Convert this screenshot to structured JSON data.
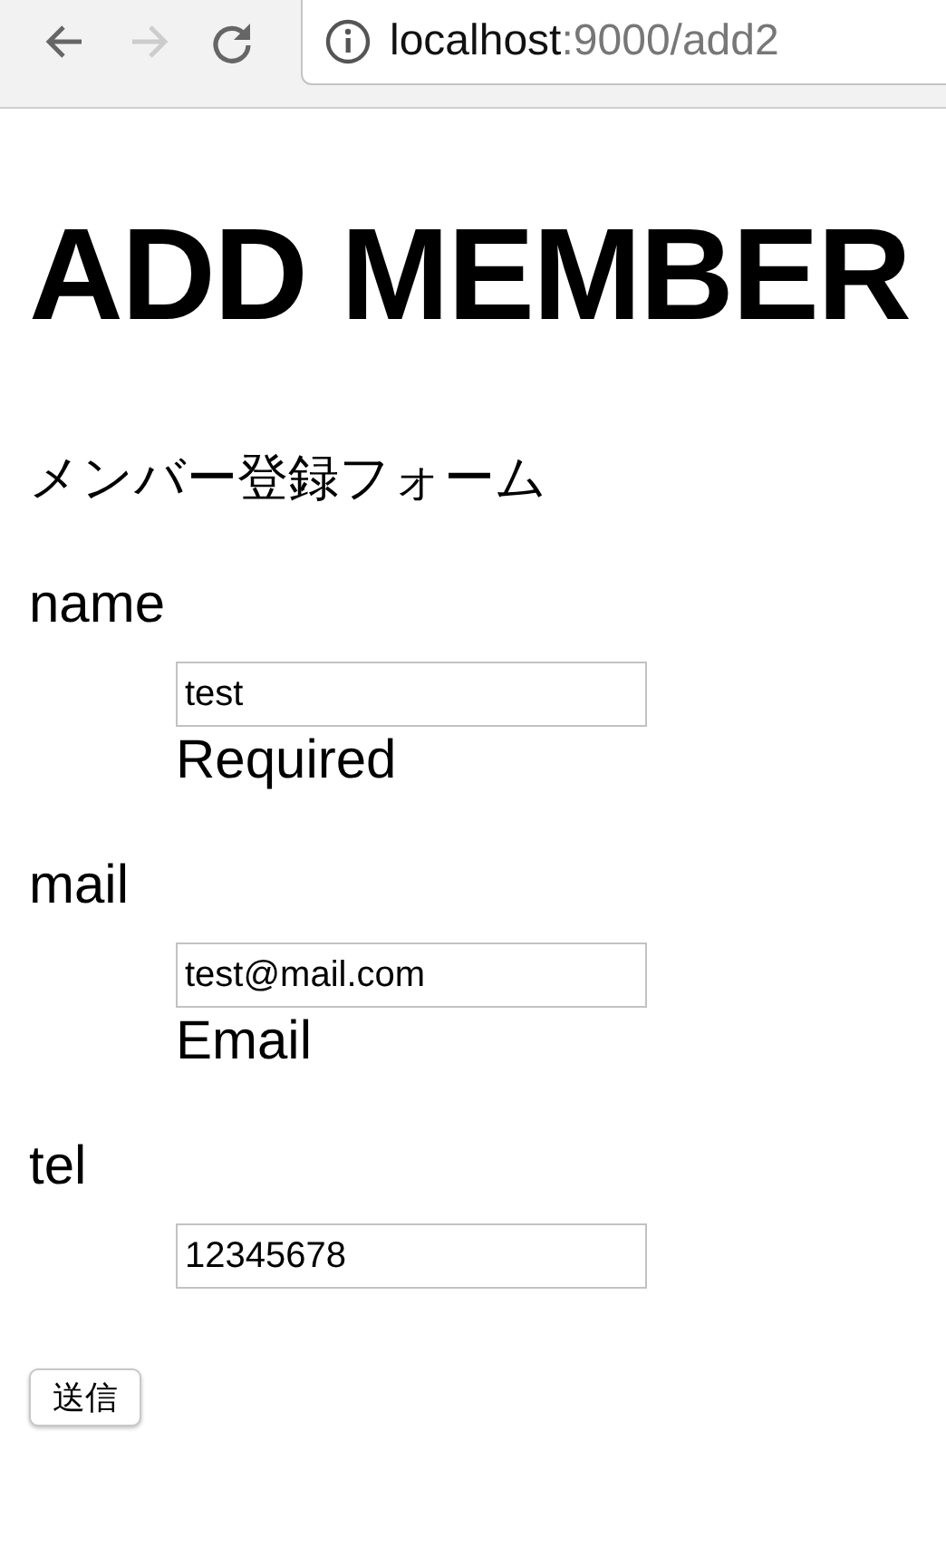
{
  "browser": {
    "nav_buttons": [
      {
        "kind": "back",
        "disabled": false
      },
      {
        "kind": "forward",
        "disabled": true
      },
      {
        "kind": "reload",
        "disabled": false
      }
    ],
    "url_host": "localhost",
    "url_path": ":9000/add2"
  },
  "title": "ADD MEMBER",
  "subtitle": "メンバー登録フォーム",
  "fields": [
    {
      "label": "name",
      "value": "test",
      "hint": "Required"
    },
    {
      "label": "mail",
      "value": "test@mail.com",
      "hint": "Email"
    },
    {
      "label": "tel",
      "value": "12345678"
    }
  ],
  "submit": "送信"
}
